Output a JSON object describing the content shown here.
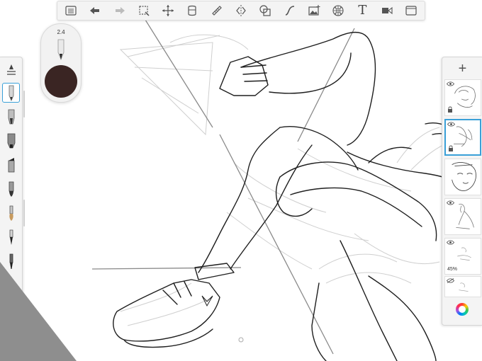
{
  "toolbar": {
    "icons": [
      "list-icon",
      "undo-icon",
      "redo-icon",
      "selection-icon",
      "transform-icon",
      "paint-bucket-icon",
      "ruler-icon",
      "symmetry-icon",
      "shapes-icon",
      "stroke-icon",
      "image-import-icon",
      "perspective-icon",
      "text-icon",
      "video-icon",
      "fullscreen-icon"
    ],
    "text_tool_glyph": "T"
  },
  "brush_puck": {
    "size": "2.4",
    "color": "#3a2523"
  },
  "brushes": [
    "pencil",
    "ink-pen",
    "marker",
    "chisel-marker",
    "paintbrush",
    "airbrush",
    "smudge",
    "fine-liner",
    "felt-pen",
    "soft-eraser",
    "hard-eraser"
  ],
  "selected_brush_index": 1,
  "layers": {
    "add_label": "+",
    "items": [
      {
        "visible": true,
        "locked": true,
        "selected": false
      },
      {
        "visible": true,
        "locked": true,
        "selected": true
      },
      {
        "visible": false,
        "locked": false,
        "selected": false
      },
      {
        "visible": true,
        "locked": false,
        "selected": false
      },
      {
        "visible": true,
        "locked": false,
        "selected": false,
        "opacity": "45%"
      },
      {
        "visible": true,
        "locked": false,
        "selected": false
      }
    ]
  },
  "colors": {
    "accent": "#3aa0d8",
    "panel": "#f4f4f4",
    "corner": "#8e8e8e"
  }
}
